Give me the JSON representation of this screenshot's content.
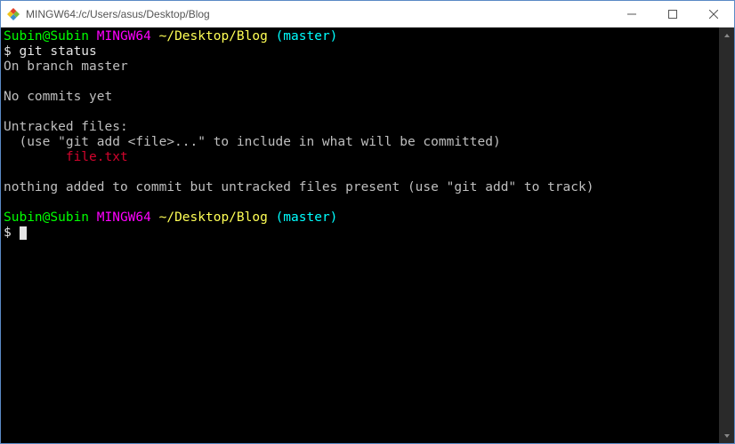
{
  "window": {
    "title": "MINGW64:/c/Users/asus/Desktop/Blog"
  },
  "prompt1": {
    "user": "Subin@Subin",
    "env": "MINGW64",
    "path": "~/Desktop/Blog",
    "branch": "(master)",
    "symbol": "$",
    "command": "git status"
  },
  "output": {
    "branch_line": "On branch master",
    "no_commits": "No commits yet",
    "untracked_header": "Untracked files:",
    "untracked_hint": "  (use \"git add <file>...\" to include in what will be committed)",
    "untracked_file": "        file.txt",
    "nothing_added": "nothing added to commit but untracked files present (use \"git add\" to track)"
  },
  "prompt2": {
    "user": "Subin@Subin",
    "env": "MINGW64",
    "path": "~/Desktop/Blog",
    "branch": "(master)",
    "symbol": "$"
  }
}
